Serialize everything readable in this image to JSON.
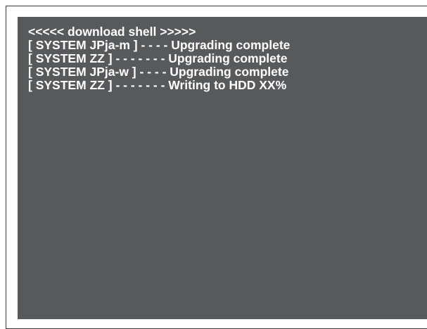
{
  "terminal": {
    "background_color": "#58595b",
    "text_color": "#ffffff",
    "lines": [
      "<<<<< download shell >>>>>",
      "[ SYSTEM JPja-m ] - - - - Upgrading complete",
      "[ SYSTEM ZZ ] - - - - - - - Upgrading complete",
      "[ SYSTEM JPja-w ] - - - - Upgrading complete",
      "[ SYSTEM ZZ ] - - - - - - - Writing to HDD XX%"
    ]
  }
}
